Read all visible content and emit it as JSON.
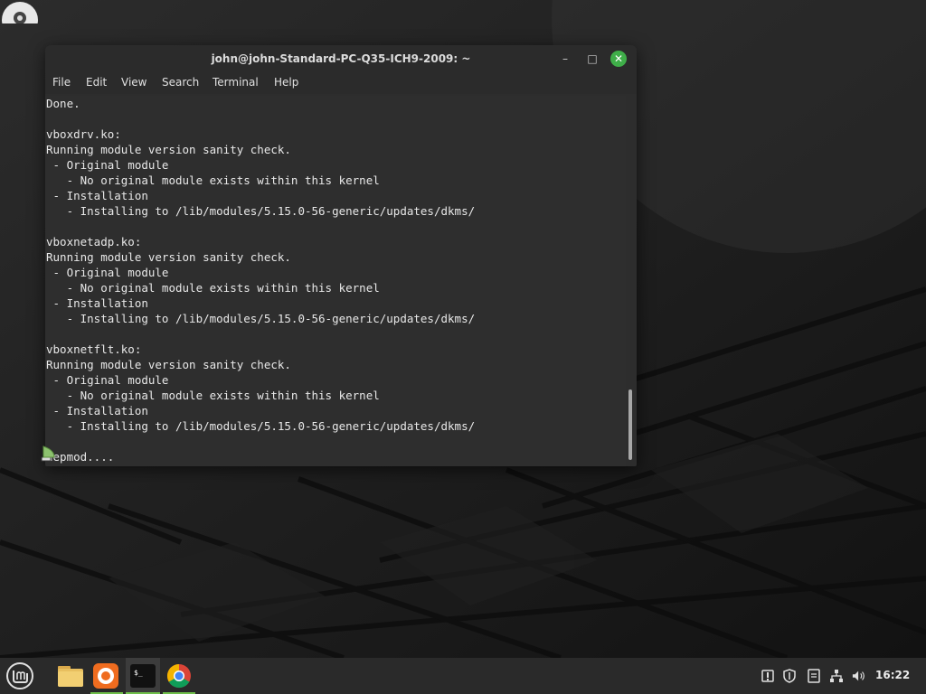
{
  "window": {
    "title": "john@john-Standard-PC-Q35-ICH9-2009: ~",
    "minimize_label": "–",
    "maximize_label": "□",
    "close_label": "✕"
  },
  "menu": {
    "file": "File",
    "edit": "Edit",
    "view": "View",
    "search": "Search",
    "terminal": "Terminal",
    "help": "Help"
  },
  "terminal": {
    "output": "Done.\n\nvboxdrv.ko:\nRunning module version sanity check.\n - Original module\n   - No original module exists within this kernel\n - Installation\n   - Installing to /lib/modules/5.15.0-56-generic/updates/dkms/\n\nvboxnetadp.ko:\nRunning module version sanity check.\n - Original module\n   - No original module exists within this kernel\n - Installation\n   - Installing to /lib/modules/5.15.0-56-generic/updates/dkms/\n\nvboxnetflt.ko:\nRunning module version sanity check.\n - Original module\n   - No original module exists within this kernel\n - Installation\n   - Installing to /lib/modules/5.15.0-56-generic/updates/dkms/\n\ndepmod...."
  },
  "taskbar": {
    "clock": "16:22",
    "apps": [
      "menu-icon",
      "files-icon",
      "firefox-icon",
      "terminal-icon",
      "chrome-icon"
    ],
    "tray": [
      "update-manager-icon",
      "shield-icon",
      "notes-icon",
      "network-icon",
      "volume-icon"
    ]
  },
  "colors": {
    "accent": "#6fbf4a",
    "close_button": "#3fae49",
    "terminal_bg": "#2e2e2e",
    "terminal_fg": "#e8e8e8"
  }
}
